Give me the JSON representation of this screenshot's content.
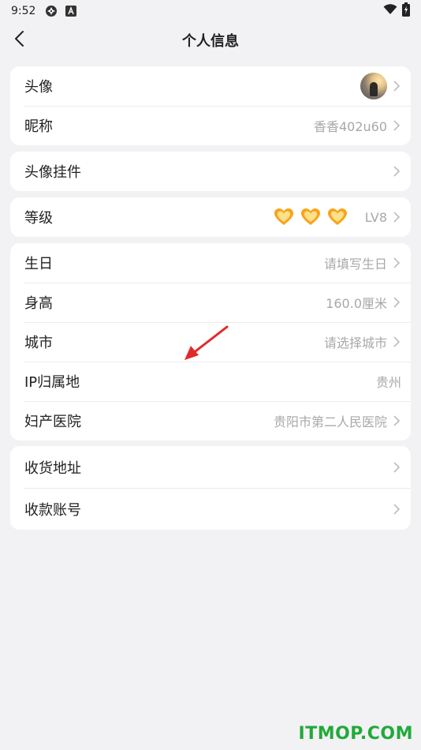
{
  "status_bar": {
    "time": "9:52",
    "icons": [
      "sync-icon",
      "app-a-icon",
      "wifi-icon",
      "battery-charging-icon"
    ]
  },
  "header": {
    "title": "个人信息",
    "back_icon": "back-chevron-icon"
  },
  "cards": {
    "profile": {
      "avatar_label": "头像",
      "nickname_label": "昵称",
      "nickname_value": "香香402u60"
    },
    "pendant": {
      "label": "头像挂件"
    },
    "level": {
      "label": "等级",
      "value": "LV8",
      "hearts": 3,
      "heart_color": "#f7a51c"
    },
    "info": {
      "birthday_label": "生日",
      "birthday_value": "请填写生日",
      "height_label": "身高",
      "height_value": "160.0厘米",
      "city_label": "城市",
      "city_value": "请选择城市",
      "ip_label": "IP归属地",
      "ip_value": "贵州",
      "hospital_label": "妇产医院",
      "hospital_value": "贵阳市第二人民医院"
    },
    "address": {
      "shipping_label": "收货地址",
      "payment_label": "收款账号"
    }
  },
  "colors": {
    "background": "#f2f2f4",
    "card": "#ffffff",
    "value_text": "#a8a8a8",
    "arrow": "#e02a2a",
    "watermark": "#22a93a"
  },
  "watermark": "ITMOP.COM"
}
